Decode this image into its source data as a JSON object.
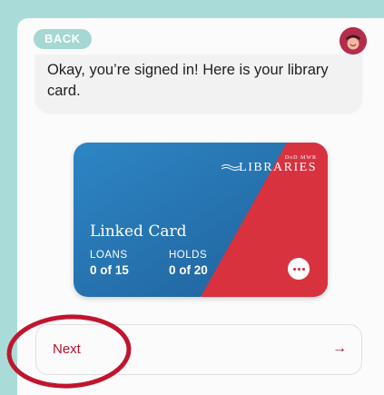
{
  "header": {
    "back_label": "BACK"
  },
  "message": {
    "text": "Okay, you’re signed in! Here is your library card."
  },
  "card": {
    "brand_top": "DoD MWR",
    "brand_name": "LIBRARIES",
    "title": "Linked Card",
    "loans_label": "LOANS",
    "loans_value": "0 of 15",
    "holds_label": "HOLDS",
    "holds_value": "0 of 20",
    "more_icon": "more-horizontal-icon"
  },
  "next": {
    "label": "Next",
    "arrow": "→"
  },
  "colors": {
    "page_bg": "#a9dcd8",
    "card_blue": "#2774b3",
    "card_red": "#d8323f",
    "accent": "#b0132b",
    "annotation": "#c0152f"
  }
}
